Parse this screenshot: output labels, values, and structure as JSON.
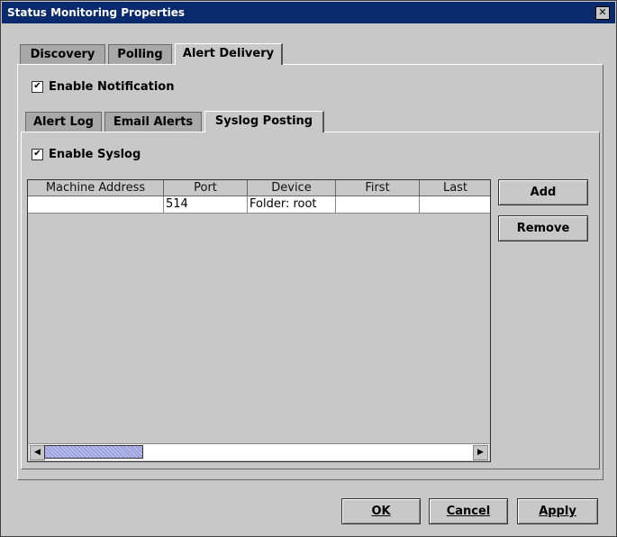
{
  "window": {
    "title": "Status Monitoring Properties",
    "close_glyph": "✕"
  },
  "main_tabs": [
    {
      "label": "Discovery",
      "active": false
    },
    {
      "label": "Polling",
      "active": false
    },
    {
      "label": "Alert Delivery",
      "active": true
    }
  ],
  "enable_notification": {
    "label": "Enable Notification",
    "checked": true
  },
  "sub_tabs": [
    {
      "label": "Alert Log",
      "active": false
    },
    {
      "label": "Email Alerts",
      "active": false
    },
    {
      "label": "Syslog Posting",
      "active": true
    }
  ],
  "enable_syslog": {
    "label": "Enable Syslog",
    "checked": true
  },
  "table": {
    "columns": [
      "Machine Address",
      "Port",
      "Device",
      "First",
      "Last"
    ],
    "rows": [
      [
        "",
        "514",
        "Folder: root",
        "",
        ""
      ]
    ],
    "scroll_left": "◀",
    "scroll_right": "▶"
  },
  "side_buttons": {
    "add": "Add",
    "remove": "Remove"
  },
  "footer_buttons": {
    "ok": "OK",
    "cancel": "Cancel",
    "apply": "Apply"
  },
  "colors": {
    "titlebar": "#0a2a6e",
    "face": "#c8c8c8",
    "inactive_tab": "#a8a8a8",
    "scroll_thumb": "#9aa0d8"
  }
}
